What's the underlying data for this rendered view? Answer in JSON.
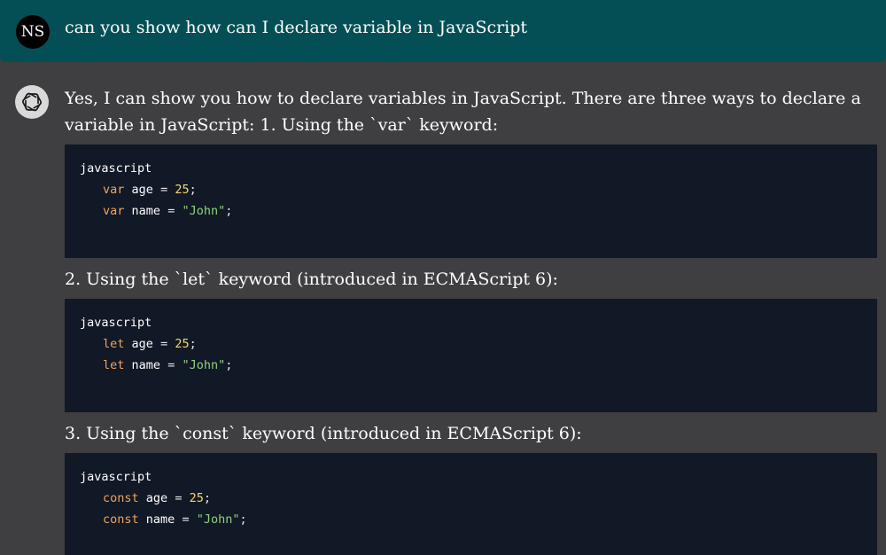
{
  "user_message": {
    "avatar_initials": "NS",
    "text": "can you show how can I declare variable in JavaScript"
  },
  "assistant_message": {
    "avatar_icon": "openai-logo-icon",
    "intro": "Yes, I can show you how to declare variables in JavaScript. There are three ways to declare a variable in JavaScript: 1. Using the `var` keyword:",
    "blocks": [
      {
        "language": "javascript",
        "lines": [
          {
            "keyword": "var",
            "name": "age",
            "op": "=",
            "value": "25",
            "value_type": "number",
            "end": ";"
          },
          {
            "keyword": "var",
            "name": "name",
            "op": "=",
            "value": "\"John\"",
            "value_type": "string",
            "end": ";"
          }
        ]
      },
      {
        "heading": "2. Using the `let` keyword (introduced in ECMAScript 6):",
        "language": "javascript",
        "lines": [
          {
            "keyword": "let",
            "name": "age",
            "op": "=",
            "value": "25",
            "value_type": "number",
            "end": ";"
          },
          {
            "keyword": "let",
            "name": "name",
            "op": "=",
            "value": "\"John\"",
            "value_type": "string",
            "end": ";"
          }
        ]
      },
      {
        "heading": "3. Using the `const` keyword (introduced in ECMAScript 6):",
        "language": "javascript",
        "lines": [
          {
            "keyword": "const",
            "name": "age",
            "op": "=",
            "value": "25",
            "value_type": "number",
            "end": ";"
          },
          {
            "keyword": "const",
            "name": "name",
            "op": "=",
            "value": "\"John\"",
            "value_type": "string",
            "end": ";"
          }
        ]
      }
    ]
  },
  "colors": {
    "user_row_bg": "#044f55",
    "assistant_bg": "#3f3e40",
    "code_bg": "#111826",
    "keyword": "#f0a45d",
    "number": "#f5d76e",
    "string": "#8fd37d"
  }
}
